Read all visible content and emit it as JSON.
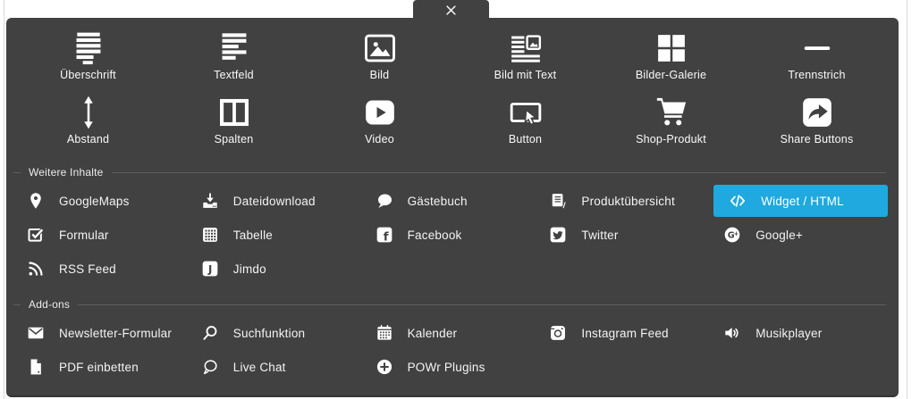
{
  "colors": {
    "panel": "#414141",
    "accent": "#1fa9de",
    "text": "#f5f5f5"
  },
  "close": {
    "icon": "close-icon"
  },
  "top_grid": {
    "items": [
      {
        "id": "ueberschrift",
        "label": "Überschrift",
        "icon": "heading"
      },
      {
        "id": "textfeld",
        "label": "Textfeld",
        "icon": "textfield"
      },
      {
        "id": "bild",
        "label": "Bild",
        "icon": "image"
      },
      {
        "id": "bild-mit-text",
        "label": "Bild mit Text",
        "icon": "image-text"
      },
      {
        "id": "bilder-galerie",
        "label": "Bilder-Galerie",
        "icon": "gallery"
      },
      {
        "id": "trennstrich",
        "label": "Trennstrich",
        "icon": "divider"
      },
      {
        "id": "abstand",
        "label": "Abstand",
        "icon": "spacing"
      },
      {
        "id": "spalten",
        "label": "Spalten",
        "icon": "columns"
      },
      {
        "id": "video",
        "label": "Video",
        "icon": "video"
      },
      {
        "id": "button",
        "label": "Button",
        "icon": "button"
      },
      {
        "id": "shop-produkt",
        "label": "Shop-Produkt",
        "icon": "cart"
      },
      {
        "id": "share-buttons",
        "label": "Share Buttons",
        "icon": "share"
      }
    ]
  },
  "sections": [
    {
      "id": "weitere-inhalte",
      "title": "Weitere Inhalte",
      "items": [
        {
          "id": "googlemaps",
          "label": "GoogleMaps",
          "icon": "map-pin"
        },
        {
          "id": "dateidownload",
          "label": "Dateidownload",
          "icon": "download"
        },
        {
          "id": "gaestebuch",
          "label": "Gästebuch",
          "icon": "chat-filled"
        },
        {
          "id": "produktuebersicht",
          "label": "Produktübersicht",
          "icon": "catalog"
        },
        {
          "id": "widget-html",
          "label": "Widget / HTML",
          "icon": "code",
          "highlighted": true
        },
        {
          "id": "formular",
          "label": "Formular",
          "icon": "form-check"
        },
        {
          "id": "tabelle",
          "label": "Tabelle",
          "icon": "table"
        },
        {
          "id": "facebook",
          "label": "Facebook",
          "icon": "facebook"
        },
        {
          "id": "twitter",
          "label": "Twitter",
          "icon": "twitter"
        },
        {
          "id": "googleplus",
          "label": "Google+",
          "icon": "googleplus"
        },
        {
          "id": "rss-feed",
          "label": "RSS Feed",
          "icon": "rss"
        },
        {
          "id": "jimdo",
          "label": "Jimdo",
          "icon": "jimdo"
        }
      ]
    },
    {
      "id": "add-ons",
      "title": "Add-ons",
      "items": [
        {
          "id": "newsletter-formular",
          "label": "Newsletter-Formular",
          "icon": "envelope"
        },
        {
          "id": "suchfunktion",
          "label": "Suchfunktion",
          "icon": "search"
        },
        {
          "id": "kalender",
          "label": "Kalender",
          "icon": "calendar"
        },
        {
          "id": "instagram-feed",
          "label": "Instagram Feed",
          "icon": "instagram"
        },
        {
          "id": "musikplayer",
          "label": "Musikplayer",
          "icon": "speaker"
        },
        {
          "id": "pdf-einbetten",
          "label": "PDF einbetten",
          "icon": "pdf"
        },
        {
          "id": "live-chat",
          "label": "Live Chat",
          "icon": "chat-outline"
        },
        {
          "id": "powr-plugins",
          "label": "POWr Plugins",
          "icon": "plus-circle"
        }
      ]
    }
  ]
}
